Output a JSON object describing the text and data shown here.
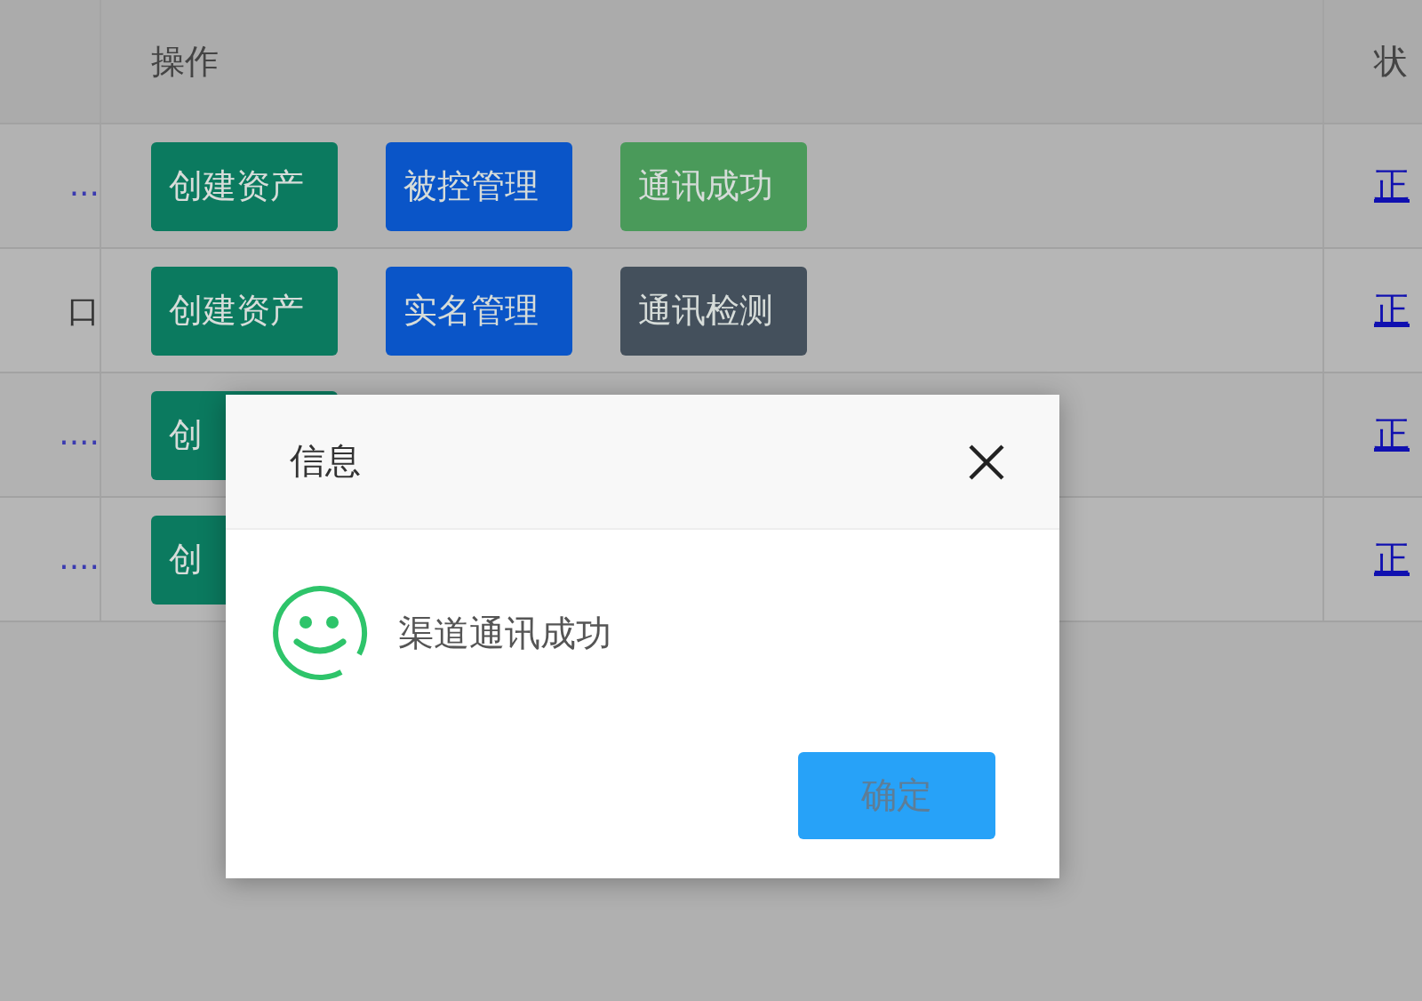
{
  "table": {
    "columns": [
      "操作",
      "状"
    ],
    "rows": [
      {
        "cell_1": "...",
        "actions": [
          {
            "label": "创建资产",
            "color": "#0b7a5f"
          },
          {
            "label": "被控管理",
            "color": "#0a55c8"
          },
          {
            "label": "通讯成功",
            "color": "#4a9a5a"
          }
        ],
        "status": "正"
      },
      {
        "cell_1": "口",
        "actions": [
          {
            "label": "创建资产",
            "color": "#0b7a5f"
          },
          {
            "label": "实名管理",
            "color": "#0a55c8"
          },
          {
            "label": "通讯检测",
            "color": "#44505c"
          }
        ],
        "status": "正"
      },
      {
        "cell_1": "....",
        "actions": [
          {
            "label": "创",
            "color": "#0b7a5f"
          }
        ],
        "status": "正"
      },
      {
        "cell_1": "....",
        "actions": [
          {
            "label": "创",
            "color": "#0b7a5f"
          }
        ],
        "status": "正"
      }
    ]
  },
  "dialog": {
    "title": "信息",
    "message": "渠道通讯成功",
    "button": "确定"
  }
}
